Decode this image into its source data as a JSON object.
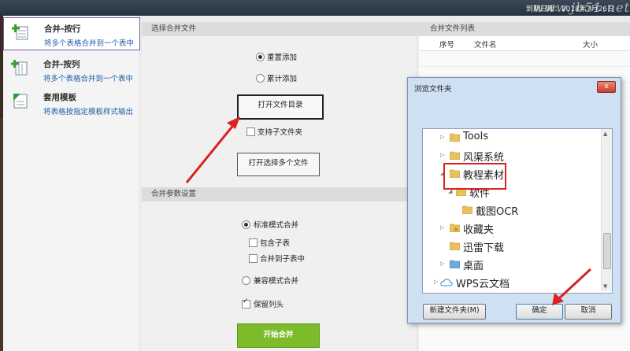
{
  "topbar": {
    "expire_text": "到期日期：2018年7月26日",
    "watermark": "www.jb51.net"
  },
  "sidebar": {
    "items": [
      {
        "title": "合并-按行",
        "desc": "将多个表格合并到一个表中"
      },
      {
        "title": "合并-按列",
        "desc": "将多个表格合并到一个表中"
      },
      {
        "title": "套用模板",
        "desc": "将表格按指定模板样式输出"
      }
    ]
  },
  "select_section": {
    "header": "选择合并文件",
    "radio_replace": "重置添加",
    "radio_append": "累计添加",
    "open_dir_button": "打开文件目录",
    "include_subfolders": "支持子文件夹",
    "open_files_button": "打开选择多个文件"
  },
  "params_section": {
    "header": "合并参数设置",
    "standard_mode": "标准模式合并",
    "include_subtables": "包含子表",
    "merge_to_subtable": "合并到子表中",
    "compat_mode": "兼容模式合并",
    "keep_header": "保留列头",
    "start_button": "开始合并"
  },
  "file_list": {
    "header": "合并文件列表",
    "columns": [
      "序号",
      "文件名",
      "大小"
    ]
  },
  "dialog": {
    "title": "浏览文件夹",
    "close_label": "x",
    "tree": [
      "Tools",
      "风渠系统",
      "教程素材",
      "软件",
      "截图OCR",
      "收藏夹",
      "迅雷下载",
      "桌面",
      "WPS云文档"
    ],
    "new_folder_button": "新建文件夹(M)",
    "ok_button": "确定",
    "cancel_button": "取消"
  },
  "colors": {
    "accent_green": "#7dbb2a",
    "annotation_red": "#dd2222",
    "link_blue": "#1f5fa8"
  }
}
